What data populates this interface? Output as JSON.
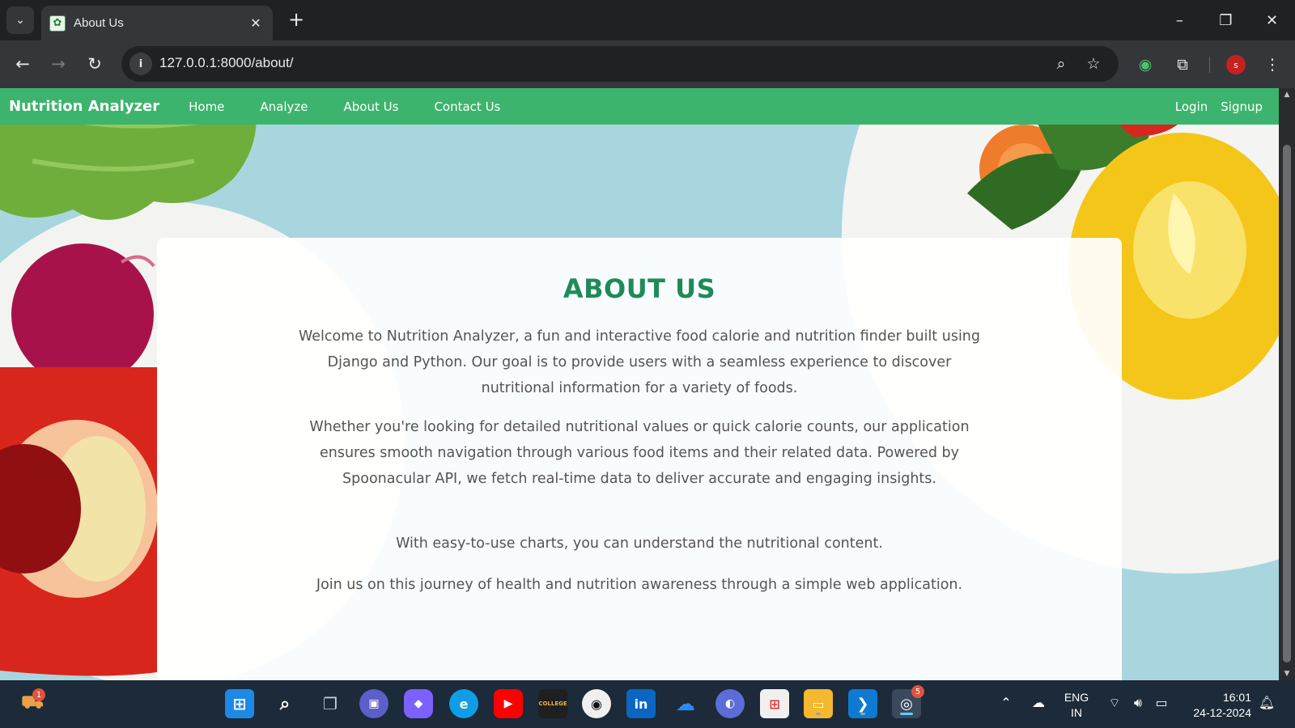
{
  "browser": {
    "tab_title": "About Us",
    "url": "127.0.0.1:8000/about/",
    "profile_initial": "s",
    "new_tab_glyph": "+",
    "tab_close_glyph": "✕"
  },
  "site": {
    "brand": "Nutrition Analyzer",
    "nav": [
      {
        "label": "Home"
      },
      {
        "label": "Analyze"
      },
      {
        "label": "About Us"
      },
      {
        "label": "Contact Us"
      }
    ],
    "auth": {
      "login": "Login",
      "signup": "Signup"
    },
    "accent_color": "#3db46d",
    "heading_color": "#1f8a5a"
  },
  "about": {
    "title": "ABOUT US",
    "paragraphs": [
      "Welcome to Nutrition Analyzer, a fun and interactive food calorie and nutrition finder built using Django and Python. Our goal is to provide users with a seamless experience to discover nutritional information for a variety of foods.",
      "Whether you're looking for detailed nutritional values or quick calorie counts, our application ensures smooth navigation through various food items and their related data. Powered by Spoonacular API, we fetch real-time data to deliver accurate and engaging insights.",
      "With easy-to-use charts, you can understand the nutritional content.",
      "Join us on this journey of health and nutrition awareness through a simple web application."
    ]
  },
  "taskbar": {
    "notification_badge": "1",
    "chrome_badge": "5",
    "language": "ENG",
    "region": "IN",
    "time": "16:01",
    "date": "24-12-2024",
    "apps": [
      {
        "icon": "windows-start-icon"
      },
      {
        "icon": "search-icon"
      },
      {
        "icon": "task-view-icon"
      },
      {
        "icon": "teams-chat-icon"
      },
      {
        "icon": "copilot-icon"
      },
      {
        "icon": "edge-icon"
      },
      {
        "icon": "youtube-icon"
      },
      {
        "icon": "college-app-icon"
      },
      {
        "icon": "github-icon"
      },
      {
        "icon": "linkedin-icon"
      },
      {
        "icon": "onedrive-icon"
      },
      {
        "icon": "teams-meeting-icon"
      },
      {
        "icon": "microsoft-store-icon"
      },
      {
        "icon": "file-explorer-icon"
      },
      {
        "icon": "vscode-icon"
      },
      {
        "icon": "chrome-icon"
      }
    ]
  }
}
